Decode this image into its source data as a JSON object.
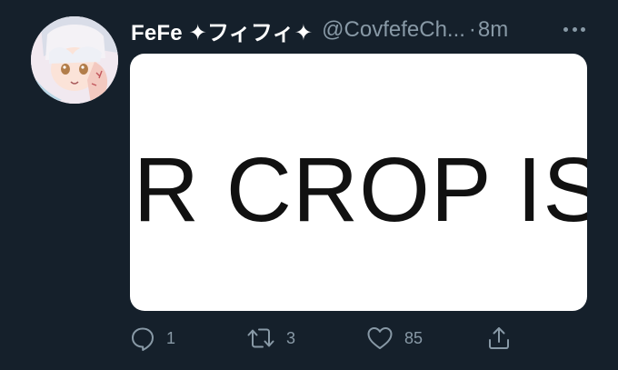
{
  "tweet": {
    "display_name": "FeFe ✦フィフィ✦",
    "handle": "@CovfefeCh...",
    "separator": "·",
    "time": "8m",
    "media_text": "ER CROP IS",
    "reply_count": "1",
    "retweet_count": "3",
    "like_count": "85"
  },
  "icons": {
    "avatar": "avatar-image",
    "more": "more-icon",
    "reply": "reply-icon",
    "retweet": "retweet-icon",
    "like": "heart-icon",
    "share": "share-icon"
  },
  "colors": {
    "background": "#15202b",
    "text": "#ffffff",
    "muted": "#8899a6"
  }
}
